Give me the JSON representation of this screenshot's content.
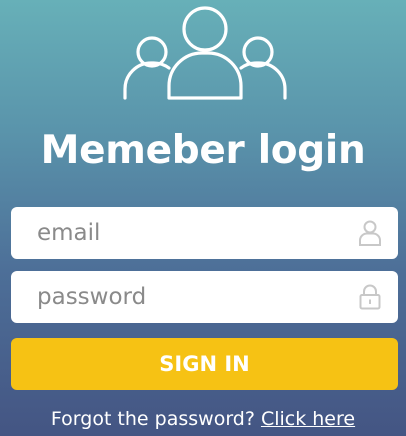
{
  "login": {
    "title": "Memeber login",
    "email_placeholder": "email",
    "password_placeholder": "password",
    "signin_label": "SIGN IN",
    "forgot_text": "Forgot the password?",
    "forgot_link": "Click here"
  },
  "icons": {
    "header": "users-group-icon",
    "email": "user-icon",
    "password": "lock-icon"
  },
  "colors": {
    "background_top": "#67b0b8",
    "background_bottom": "#445583",
    "button": "#f6c214",
    "text": "#ffffff",
    "field_bg": "#ffffff",
    "field_icon": "#c8c8c8"
  }
}
